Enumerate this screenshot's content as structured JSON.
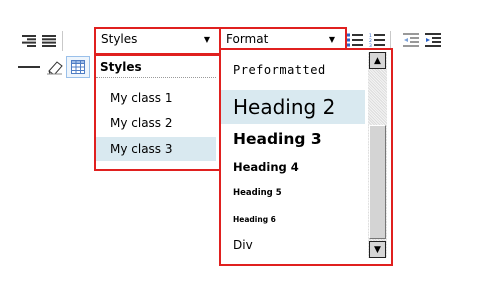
{
  "toolbar": {
    "align_right_icon": "align-right-icon",
    "justify_icon": "justify-icon",
    "styles_combo": {
      "value": "Styles"
    },
    "format_combo": {
      "value": "Format"
    },
    "bulleted_list_icon": "bulleted-list-icon",
    "numbered_list_icon": "numbered-list-icon",
    "outdent_icon": "outdent-icon",
    "indent_icon": "indent-icon",
    "horizontal_rule_icon": "horizontal-rule-icon",
    "eraser_icon": "eraser-icon",
    "table_icon": "table-icon"
  },
  "styles_menu": {
    "header": "Styles",
    "items": [
      "My class 1",
      "My class 2",
      "My class 3"
    ],
    "selected_index": 2
  },
  "format_menu": {
    "items": [
      "Preformatted",
      "Heading 2",
      "Heading 3",
      "Heading 4",
      "Heading 5",
      "Heading 6",
      "Div"
    ],
    "selected_index": 1
  },
  "colors": {
    "highlight_border": "#e0201f",
    "selection_bg": "#d9e9f0"
  }
}
